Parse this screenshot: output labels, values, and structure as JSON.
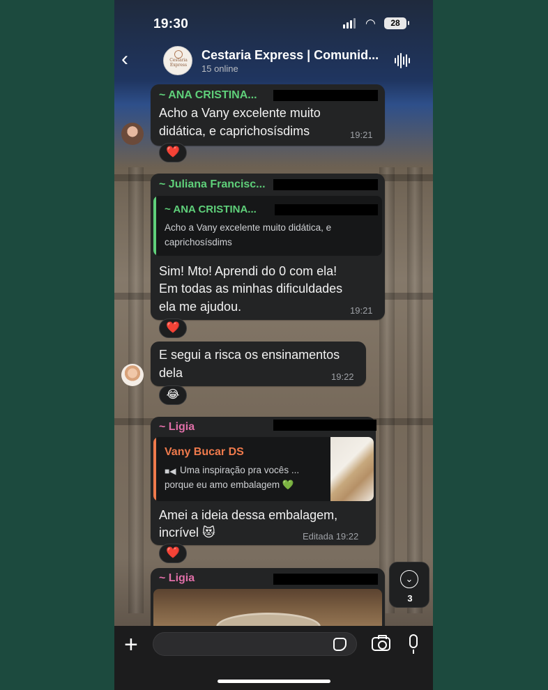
{
  "status_bar": {
    "time": "19:30",
    "battery": "28"
  },
  "header": {
    "back_icon": "chevron-left-icon",
    "avatar_logo_text": "Cestaria Express",
    "title": "Cestaria Express | Comunid...",
    "subtitle": "15 online",
    "audio_icon": "waveform-icon"
  },
  "messages": [
    {
      "sender": "~ ANA CRISTINA...",
      "sender_color": "#5fd07a",
      "lines": [
        "Acho a Vany excelente muito",
        "didática, e caprichosísdims"
      ],
      "time": "19:21",
      "reaction": "❤️"
    },
    {
      "sender": "~ Juliana Francisc...",
      "sender_color": "#5fd07a",
      "quote": {
        "name": "~ ANA CRISTINA...",
        "name_color": "#5fd07a",
        "lines": [
          "Acho a Vany excelente muito didática, e",
          "caprichosísdims"
        ]
      },
      "lines": [
        "Sim! Mto! Aprendi do 0 com ela!",
        "Em todas as minhas dificuldades",
        "ela me ajudou."
      ],
      "time": "19:21",
      "reaction": "❤️"
    },
    {
      "lines": [
        "E segui a risca os ensinamentos",
        "dela"
      ],
      "time": "19:22",
      "reaction": "😂"
    },
    {
      "sender": "~ Ligia",
      "sender_color": "#e06fa8",
      "quote": {
        "name": "Vany Bucar DS",
        "name_color": "#ef7a4c",
        "lines": [
          "Uma inspiração pra vocês ...",
          "porque eu amo embalagem 💚"
        ]
      },
      "lines": [
        "Amei a ideia dessa embalagem,",
        "incrível 😻"
      ],
      "time": "Editada  19:22",
      "reaction": "❤️"
    },
    {
      "sender": "~ Ligia",
      "sender_color": "#e06fa8"
    }
  ],
  "scroll_down": {
    "count": "3"
  },
  "input": {
    "placeholder": ""
  }
}
